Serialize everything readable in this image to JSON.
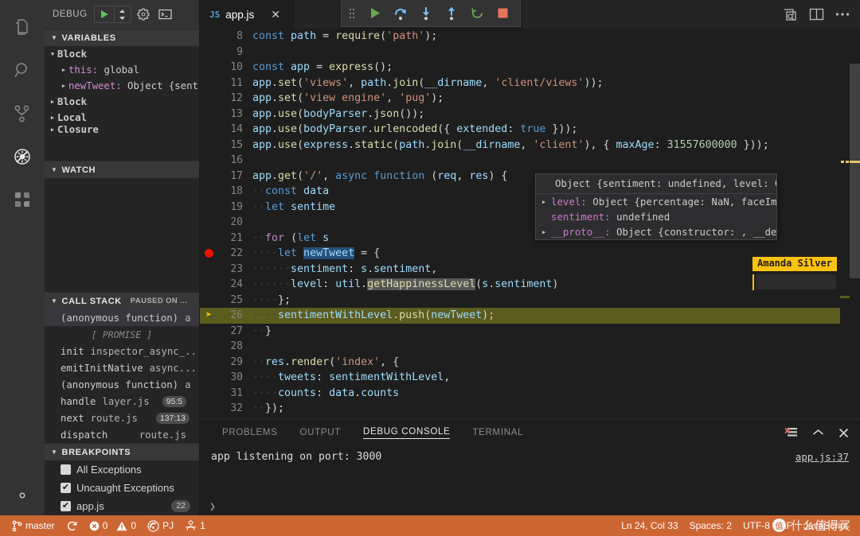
{
  "activity_bar": {
    "items": [
      {
        "name": "explorer-icon",
        "label": "Explorer"
      },
      {
        "name": "search-icon",
        "label": "Search"
      },
      {
        "name": "source-control-icon",
        "label": "Source Control"
      },
      {
        "name": "debug-icon",
        "label": "Debug"
      },
      {
        "name": "extensions-icon",
        "label": "Extensions"
      }
    ],
    "bottom": [
      {
        "name": "manage-gear-icon",
        "label": "Manage"
      }
    ]
  },
  "sidebar": {
    "title": "DEBUG",
    "toolbar": [
      {
        "name": "start-debugging-button",
        "label": "Start Debugging"
      },
      {
        "name": "configuration-dropdown",
        "label": "Select configuration"
      },
      {
        "name": "debug-settings-gear",
        "label": "Open launch.json"
      },
      {
        "name": "debug-console-toggle",
        "label": "Debug Console"
      }
    ],
    "sections": {
      "variables": {
        "header": "VARIABLES",
        "expanded": true,
        "rows": [
          {
            "indent": 0,
            "arrow": "open",
            "name": "Block",
            "bold": true,
            "value": ""
          },
          {
            "indent": 1,
            "arrow": "closed",
            "name": "this:",
            "value": "global"
          },
          {
            "indent": 1,
            "arrow": "closed",
            "name": "newTweet:",
            "value": "Object {sent."
          },
          {
            "indent": 0,
            "arrow": "closed",
            "name": "Block",
            "bold": true,
            "value": ""
          },
          {
            "indent": 0,
            "arrow": "closed",
            "name": "Local",
            "bold": true,
            "value": ""
          },
          {
            "indent": 0,
            "arrow": "closed",
            "name": "Closure",
            "bold": true,
            "value": ""
          }
        ]
      },
      "watch": {
        "header": "WATCH",
        "expanded": true,
        "rows": []
      },
      "call_stack": {
        "header": "CALL STACK",
        "subtitle": "PAUSED ON ...",
        "expanded": true,
        "rows": [
          {
            "fn": "(anonymous function)",
            "file": "a",
            "pos": "",
            "selected": true
          },
          {
            "promise": "[ PROMISE ]"
          },
          {
            "fn": "init",
            "file": "inspector_async_..",
            "pos": ""
          },
          {
            "fn": "emitInitNative",
            "file": "async...",
            "pos": ""
          },
          {
            "fn": "(anonymous function)",
            "file": "a",
            "pos": ""
          },
          {
            "fn": "handle",
            "file": "layer.js",
            "pos": "95:5"
          },
          {
            "fn": "next",
            "file": "route.js",
            "pos": "137:13"
          },
          {
            "fn": "dispatch",
            "file": "route.js",
            "pos": ""
          }
        ]
      },
      "breakpoints": {
        "header": "BREAKPOINTS",
        "expanded": true,
        "rows": [
          {
            "label": "All Exceptions",
            "checked": false,
            "line": ""
          },
          {
            "label": "Uncaught Exceptions",
            "checked": true,
            "line": ""
          },
          {
            "label": "app.js",
            "checked": true,
            "line": "22"
          }
        ]
      }
    }
  },
  "tabs": [
    {
      "icon": "js-file-icon",
      "icon_label": "JS",
      "label": "app.js",
      "active": true,
      "close": "✕"
    }
  ],
  "editor_actions": [
    {
      "name": "open-preview-icon",
      "label": "Open Preview"
    },
    {
      "name": "split-editor-icon",
      "label": "Split Editor"
    },
    {
      "name": "more-actions-icon",
      "label": "More Actions..."
    }
  ],
  "debug_toolbar": [
    {
      "name": "drag-handle-icon",
      "label": "Drag"
    },
    {
      "name": "continue-button",
      "label": "Continue",
      "color": "#6aa84f"
    },
    {
      "name": "step-over-button",
      "label": "Step Over",
      "color": "#75beff"
    },
    {
      "name": "step-into-button",
      "label": "Step Into",
      "color": "#75beff"
    },
    {
      "name": "step-out-button",
      "label": "Step Out",
      "color": "#75beff"
    },
    {
      "name": "restart-button",
      "label": "Restart",
      "color": "#6aa84f"
    },
    {
      "name": "stop-button",
      "label": "Stop",
      "color": "#e8745a"
    }
  ],
  "editor": {
    "file": "app.js",
    "language": "JavaScript",
    "first_visible_line": 8,
    "breakpoint_line": 22,
    "current_line": 26,
    "lines": [
      {
        "n": 8,
        "html": "<span class=\"kw\">const</span> <span class=\"id\">path</span> <span class=\"pun\">=</span> <span class=\"fnc\">require</span><span class=\"pun\">(</span><span class=\"str\">'path'</span><span class=\"pun\">);</span>",
        "text": "const path = require('path');"
      },
      {
        "n": 9,
        "html": "",
        "text": ""
      },
      {
        "n": 10,
        "html": "<span class=\"kw\">const</span> <span class=\"id\">app</span> <span class=\"pun\">=</span> <span class=\"fnc\">express</span><span class=\"pun\">();</span>",
        "text": "const app = express();"
      },
      {
        "n": 11,
        "html": "<span class=\"id\">app</span><span class=\"pun\">.</span><span class=\"fnc\">set</span><span class=\"pun\">(</span><span class=\"str\">'views'</span><span class=\"pun\">,</span> <span class=\"id\">path</span><span class=\"pun\">.</span><span class=\"fnc\">join</span><span class=\"pun\">(</span><span class=\"id\">__dirname</span><span class=\"pun\">,</span> <span class=\"str\">'client/views'</span><span class=\"pun\">));</span>",
        "text": "app.set('views', path.join(__dirname, 'client/views'));"
      },
      {
        "n": 12,
        "html": "<span class=\"id\">app</span><span class=\"pun\">.</span><span class=\"fnc\">set</span><span class=\"pun\">(</span><span class=\"str\">'view engine'</span><span class=\"pun\">,</span> <span class=\"str\">'pug'</span><span class=\"pun\">);</span>",
        "text": "app.set('view engine', 'pug');"
      },
      {
        "n": 13,
        "html": "<span class=\"id\">app</span><span class=\"pun\">.</span><span class=\"fnc\">use</span><span class=\"pun\">(</span><span class=\"id\">bodyParser</span><span class=\"pun\">.</span><span class=\"fnc\">json</span><span class=\"pun\">());</span>",
        "text": "app.use(bodyParser.json());"
      },
      {
        "n": 14,
        "html": "<span class=\"id\">app</span><span class=\"pun\">.</span><span class=\"fnc\">use</span><span class=\"pun\">(</span><span class=\"id\">bodyParser</span><span class=\"pun\">.</span><span class=\"fnc\">urlencoded</span><span class=\"pun\">({</span> <span class=\"id\">extended</span><span class=\"pun\">:</span> <span class=\"kw\">true</span> <span class=\"pun\">}));</span>",
        "text": "app.use(bodyParser.urlencoded({ extended: true }));"
      },
      {
        "n": 15,
        "html": "<span class=\"id\">app</span><span class=\"pun\">.</span><span class=\"fnc\">use</span><span class=\"pun\">(</span><span class=\"id\">express</span><span class=\"pun\">.</span><span class=\"fnc\">static</span><span class=\"pun\">(</span><span class=\"id\">path</span><span class=\"pun\">.</span><span class=\"fnc\">join</span><span class=\"pun\">(</span><span class=\"id\">__dirname</span><span class=\"pun\">,</span> <span class=\"str\">'client'</span><span class=\"pun\">),</span> <span class=\"pun\">{</span> <span class=\"id\">maxAge</span><span class=\"pun\">:</span> <span class=\"num\">31557600000</span> <span class=\"pun\">}));</span>",
        "text": "app.use(express.static(path.join(__dirname, 'client'), { maxAge: 31557600000 }));"
      },
      {
        "n": 16,
        "html": "",
        "text": ""
      },
      {
        "n": 17,
        "html": "<span class=\"id\">app</span><span class=\"pun\">.</span><span class=\"fnc\">get</span><span class=\"pun\">(</span><span class=\"str\">'/'</span><span class=\"pun\">,</span> <span class=\"kw\">async</span> <span class=\"kw\">function</span> <span class=\"pun\">(</span><span class=\"id\">req</span><span class=\"pun\">,</span> <span class=\"id\">res</span><span class=\"pun\">) {</span>",
        "text": "app.get('/', async function (req, res) {"
      },
      {
        "n": 18,
        "html": "<span class=\"ws\">··</span><span class=\"kw\">const</span> <span class=\"id\">data</span>",
        "text": "  const data"
      },
      {
        "n": 19,
        "html": "<span class=\"ws\">··</span><span class=\"kw\">let</span> <span class=\"id\">sentime</span>",
        "text": "  let sentime"
      },
      {
        "n": 20,
        "html": "",
        "text": ""
      },
      {
        "n": 21,
        "html": "<span class=\"ws\">··</span><span class=\"kw2\">for</span> <span class=\"pun\">(</span><span class=\"kw\">let</span> <span class=\"id\">s</span>",
        "text": "  for (let s"
      },
      {
        "n": 22,
        "html": "<span class=\"ws\">··</span><span class=\"ws\">··</span><span class=\"kw\">let</span> <span class=\"sel-box id\">newTweet</span> <span class=\"pun\">= {</span>",
        "text": "    let newTweet = {"
      },
      {
        "n": 23,
        "html": "<span class=\"ws\">··</span><span class=\"ws\">··</span><span class=\"ws\">··</span><span class=\"id\">sentiment</span><span class=\"pun\">:</span> <span class=\"id\">s</span><span class=\"pun\">.</span><span class=\"id\">sentiment</span><span class=\"pun\">,</span>",
        "text": "      sentiment: s.sentiment,"
      },
      {
        "n": 24,
        "html": "<span class=\"ws\">··</span><span class=\"ws\">··</span><span class=\"ws\">··</span><span class=\"id\">level</span><span class=\"pun\">:</span> <span class=\"id\">util</span><span class=\"pun\">.</span><span class=\"wordhl fnc\">getHappinessLevel</span><span class=\"pun\">(</span><span class=\"id\">s</span><span class=\"pun\">.</span><span class=\"id\">sentiment</span><span class=\"pun\">)</span>",
        "text": "      level: util.getHappinessLevel(s.sentiment)"
      },
      {
        "n": 25,
        "html": "<span class=\"ws\">··</span><span class=\"ws\">··</span><span class=\"pun\">};</span>",
        "text": "    };"
      },
      {
        "n": 26,
        "html": "<span class=\"ws\">··</span><span class=\"ws\">··</span><span class=\"id\">sentimentWithLevel</span><span class=\"pun\">.</span><span class=\"fnc\">push</span><span class=\"pun\">(</span><span class=\"id\">newTweet</span><span class=\"pun\">);</span>",
        "text": "    sentimentWithLevel.push(newTweet);"
      },
      {
        "n": 27,
        "html": "<span class=\"ws\">··</span><span class=\"pun\">}</span>",
        "text": "  }"
      },
      {
        "n": 28,
        "html": "",
        "text": ""
      },
      {
        "n": 29,
        "html": "<span class=\"ws\">··</span><span class=\"id\">res</span><span class=\"pun\">.</span><span class=\"fnc\">render</span><span class=\"pun\">(</span><span class=\"str\">'index'</span><span class=\"pun\">, {</span>",
        "text": "  res.render('index', {"
      },
      {
        "n": 30,
        "html": "<span class=\"ws\">··</span><span class=\"ws\">··</span><span class=\"id\">tweets</span><span class=\"pun\">:</span> <span class=\"id\">sentimentWithLevel</span><span class=\"pun\">,</span>",
        "text": "    tweets: sentimentWithLevel,"
      },
      {
        "n": 31,
        "html": "<span class=\"ws\">··</span><span class=\"ws\">··</span><span class=\"id\">counts</span><span class=\"pun\">:</span> <span class=\"id\">data</span><span class=\"pun\">.</span><span class=\"id\">counts</span>",
        "text": "    counts: data.counts"
      },
      {
        "n": 32,
        "html": "<span class=\"ws\">··</span><span class=\"pun\">});</span>",
        "text": "  });"
      }
    ]
  },
  "hover_popup": {
    "title": "Object {sentiment: undefined, level: Object}",
    "rows": [
      {
        "arrow": true,
        "name": "level:",
        "value": "Object {percentage: NaN, faceImage: \"/a"
      },
      {
        "arrow": false,
        "name": "sentiment:",
        "value": "undefined"
      },
      {
        "arrow": true,
        "name": "__proto__:",
        "value": "Object {constructor: , __defineGette"
      }
    ]
  },
  "collaborator": {
    "name": "Amanda Silver",
    "color": "#ffc20e"
  },
  "panel": {
    "tabs": [
      {
        "label": "PROBLEMS",
        "active": false
      },
      {
        "label": "OUTPUT",
        "active": false
      },
      {
        "label": "DEBUG CONSOLE",
        "active": true
      },
      {
        "label": "TERMINAL",
        "active": false
      }
    ],
    "actions": [
      {
        "name": "clear-console-icon",
        "label": "Clear Console"
      },
      {
        "name": "maximize-panel-icon",
        "label": "Maximize Panel Size"
      },
      {
        "name": "close-panel-icon",
        "label": "Close Panel"
      }
    ],
    "console_output": "app listening on port: 3000",
    "console_source": "app.js:37",
    "input_prompt": "❯"
  },
  "statusbar": {
    "background": "#cc6633",
    "left": [
      {
        "name": "branch-status",
        "icon": "source-control-branch-icon",
        "label": "master"
      },
      {
        "name": "sync-status",
        "icon": "sync-icon",
        "label": ""
      },
      {
        "name": "problems-status",
        "icon": "error-warning-icons",
        "errors": "0",
        "warnings": "0"
      },
      {
        "name": "liveshare-status",
        "icon": "broadcast-icon",
        "label": "PJ"
      },
      {
        "name": "liveshare-participants",
        "icon": "people-icon",
        "label": "1"
      }
    ],
    "right": [
      {
        "name": "cursor-position-status",
        "label": "Ln 24, Col 33"
      },
      {
        "name": "indentation-status",
        "label": "Spaces: 2"
      },
      {
        "name": "encoding-status",
        "label": "UTF-8"
      },
      {
        "name": "eol-status",
        "label": "LF"
      },
      {
        "name": "language-mode-status",
        "label": "JavaScript"
      }
    ]
  },
  "watermark": {
    "badge": "值",
    "text": "什么值得买"
  }
}
